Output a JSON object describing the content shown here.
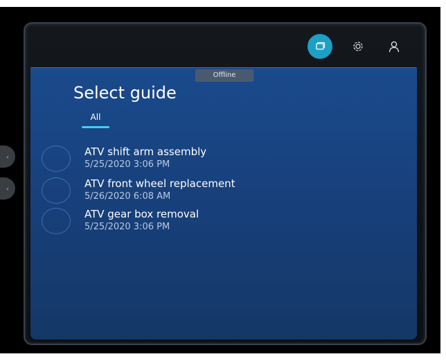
{
  "status": {
    "offline_label": "Offline"
  },
  "topbar": {
    "items": [
      {
        "icon": "guides-icon",
        "active": true
      },
      {
        "icon": "gear-icon",
        "active": false
      },
      {
        "icon": "user-icon",
        "active": false
      }
    ]
  },
  "panel": {
    "title": "Select guide",
    "tabs": [
      {
        "label": "All",
        "selected": true
      }
    ]
  },
  "guides": [
    {
      "name": "ATV shift arm assembly",
      "date": "5/25/2020 3:06 PM"
    },
    {
      "name": "ATV front wheel replacement",
      "date": "5/26/2020 6:08 AM"
    },
    {
      "name": "ATV gear box removal",
      "date": "5/25/2020 3:06 PM"
    }
  ],
  "colors": {
    "accent": "#1e9fc4",
    "tab_underline": "#3fd0f0",
    "panel_bg": "#1a4a8c"
  }
}
